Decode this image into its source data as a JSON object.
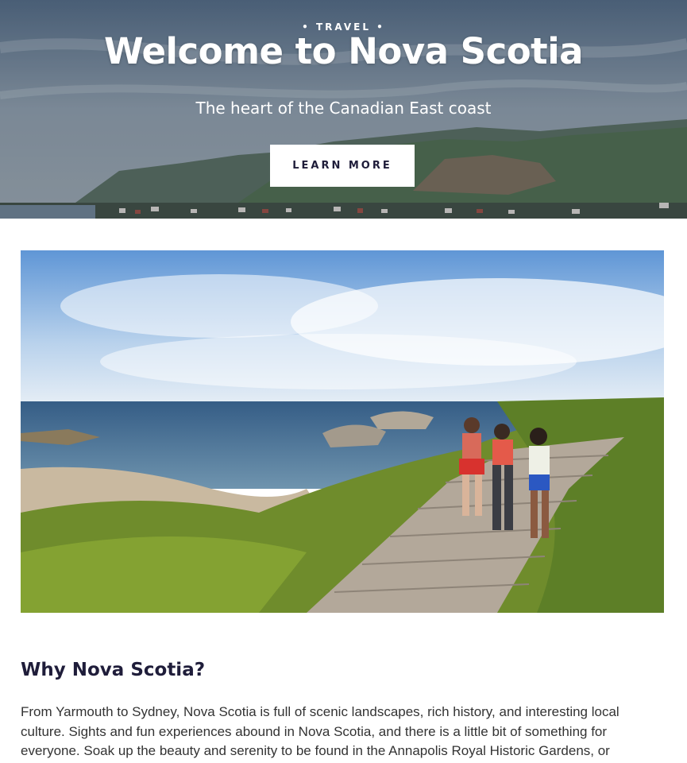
{
  "hero": {
    "eyebrow": "• TRAVEL •",
    "title": "Welcome to Nova Scotia",
    "subtitle": "The heart of the Canadian East coast",
    "cta_label": "LEARN MORE"
  },
  "main_image": {
    "icon": "coastal-boardwalk-photo"
  },
  "section": {
    "title": "Why Nova Scotia?",
    "paragraph": "From Yarmouth to Sydney, Nova Scotia is full of scenic landscapes, rich history, and interesting local culture. Sights and fun experiences abound in Nova Scotia, and there is a little bit of something for everyone. Soak up the beauty and serenity to be found in the Annapolis Royal Historic Gardens, or"
  },
  "colors": {
    "heading": "#1f1d3a",
    "body_text": "#333333",
    "button_bg": "#ffffff"
  }
}
